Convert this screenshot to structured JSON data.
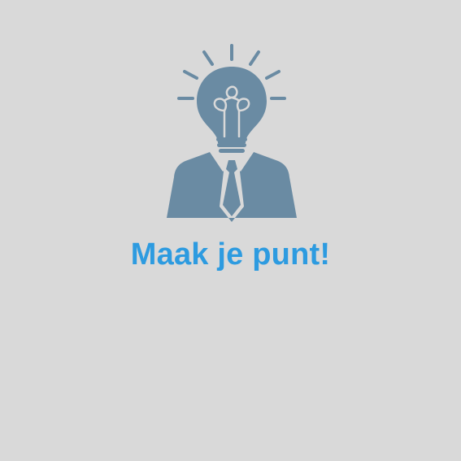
{
  "slogan": {
    "text": "Maak je punt!"
  },
  "colors": {
    "background": "#d9d9d9",
    "icon": "#6a8ba3",
    "filament": "#d9d9d9",
    "slogan": "#2d9be0"
  },
  "icons": {
    "logo": "lightbulb-head-person-icon"
  }
}
